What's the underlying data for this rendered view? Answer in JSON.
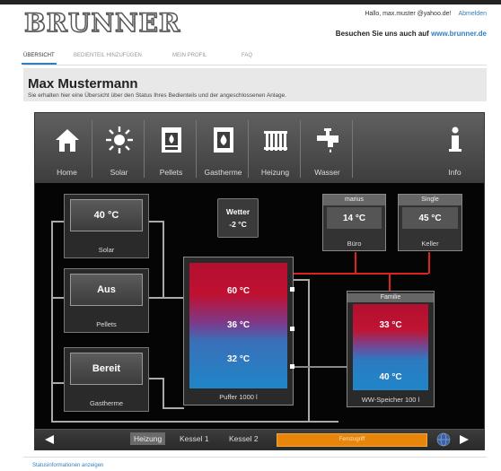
{
  "header": {
    "brand": "BRUNNER",
    "hello_text": "Hallo, max.muster @yahoo.de!",
    "logout_label": "Abmelden",
    "visit_text": "Besuchen Sie uns auch auf",
    "visit_link": "www.brunner.de"
  },
  "nav": {
    "items": [
      "ÜBERSICHT",
      "BEDIENTEIL HINZUFÜGEN",
      "MEIN PROFIL",
      "FAQ"
    ]
  },
  "page": {
    "title": "Max Mustermann",
    "subtitle": "Sie erhalten hier eine Übersicht über den Status Ihres Bedienteils und der angeschlossenen Anlage."
  },
  "panel": {
    "toolbar": [
      "Home",
      "Solar",
      "Pellets",
      "Gastherme",
      "Heizung",
      "Wasser",
      "Info"
    ],
    "solar": {
      "value": "40 °C",
      "label": "Solar"
    },
    "pellets": {
      "value": "Aus",
      "label": "Pellets"
    },
    "gastherme": {
      "value": "Bereit",
      "label": "Gastherme"
    },
    "wetter": {
      "title": "Wetter",
      "value": "-2 °C"
    },
    "rooms": [
      {
        "top": "marius",
        "value": "14 °C",
        "label": "Büro"
      },
      {
        "top": "Single",
        "value": "45 °C",
        "label": "Keller"
      }
    ],
    "puffer": {
      "temps": [
        "60 °C",
        "36 °C",
        "32 °C"
      ],
      "label": "Puffer 1000 l"
    },
    "ww": {
      "top": "Familie",
      "temps": [
        "33 °C",
        "40 °C"
      ],
      "label": "WW-Speicher 100 l"
    },
    "bottom": {
      "tabs": [
        "Heizung",
        "Kessel 1",
        "Kessel 2"
      ],
      "remote": "Fernzugriff"
    }
  },
  "footer": {
    "status_link": "Statusinformationen anzeigen"
  },
  "colors": {
    "accent": "#2f7fc0",
    "remote": "#e8860c"
  }
}
